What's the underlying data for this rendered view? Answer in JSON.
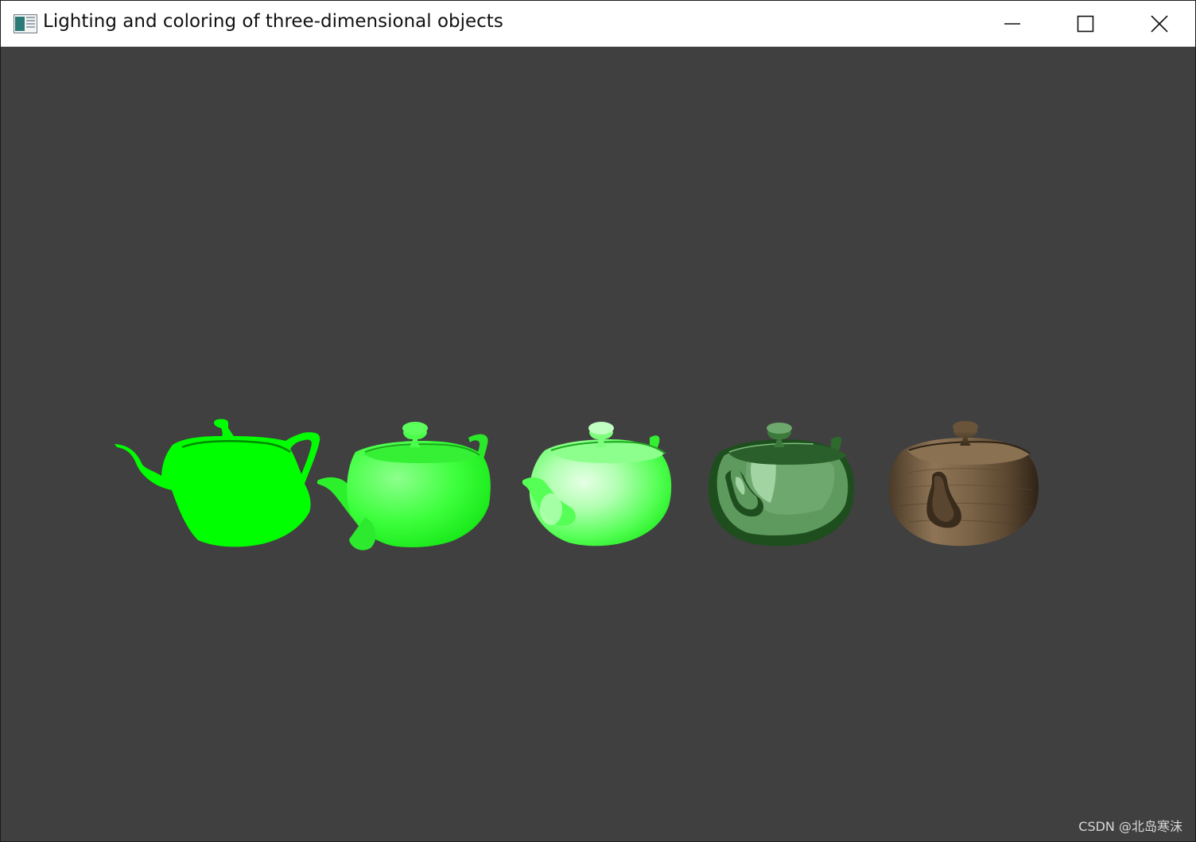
{
  "window": {
    "title": "Lighting and coloring of three-dimensional objects",
    "icon": "application-window-icon",
    "controls": [
      "minimize-icon",
      "maximize-icon",
      "close-icon"
    ]
  },
  "viewport": {
    "background": "#404040",
    "teapots": [
      {
        "name": "flat-green",
        "shading": "unlit flat",
        "colors": [
          "#00ff00",
          "#00ff00",
          "#00ff00"
        ]
      },
      {
        "name": "diffuse-green",
        "shading": "diffuse",
        "colors": [
          "#8dff8d",
          "#3dff3d",
          "#14e614"
        ]
      },
      {
        "name": "specular-green",
        "shading": "diffuse + specular",
        "colors": [
          "#e6ffe6",
          "#7dff7d",
          "#22ee22"
        ]
      },
      {
        "name": "toon-green",
        "shading": "toon / cel",
        "colors": [
          "#a2d3a2",
          "#5e9a5e",
          "#1e4e1e"
        ]
      },
      {
        "name": "wood",
        "shading": "textured wood",
        "colors": [
          "#8f7556",
          "#6a5439",
          "#2e2316"
        ]
      }
    ]
  },
  "watermark": "CSDN @北岛寒沫"
}
